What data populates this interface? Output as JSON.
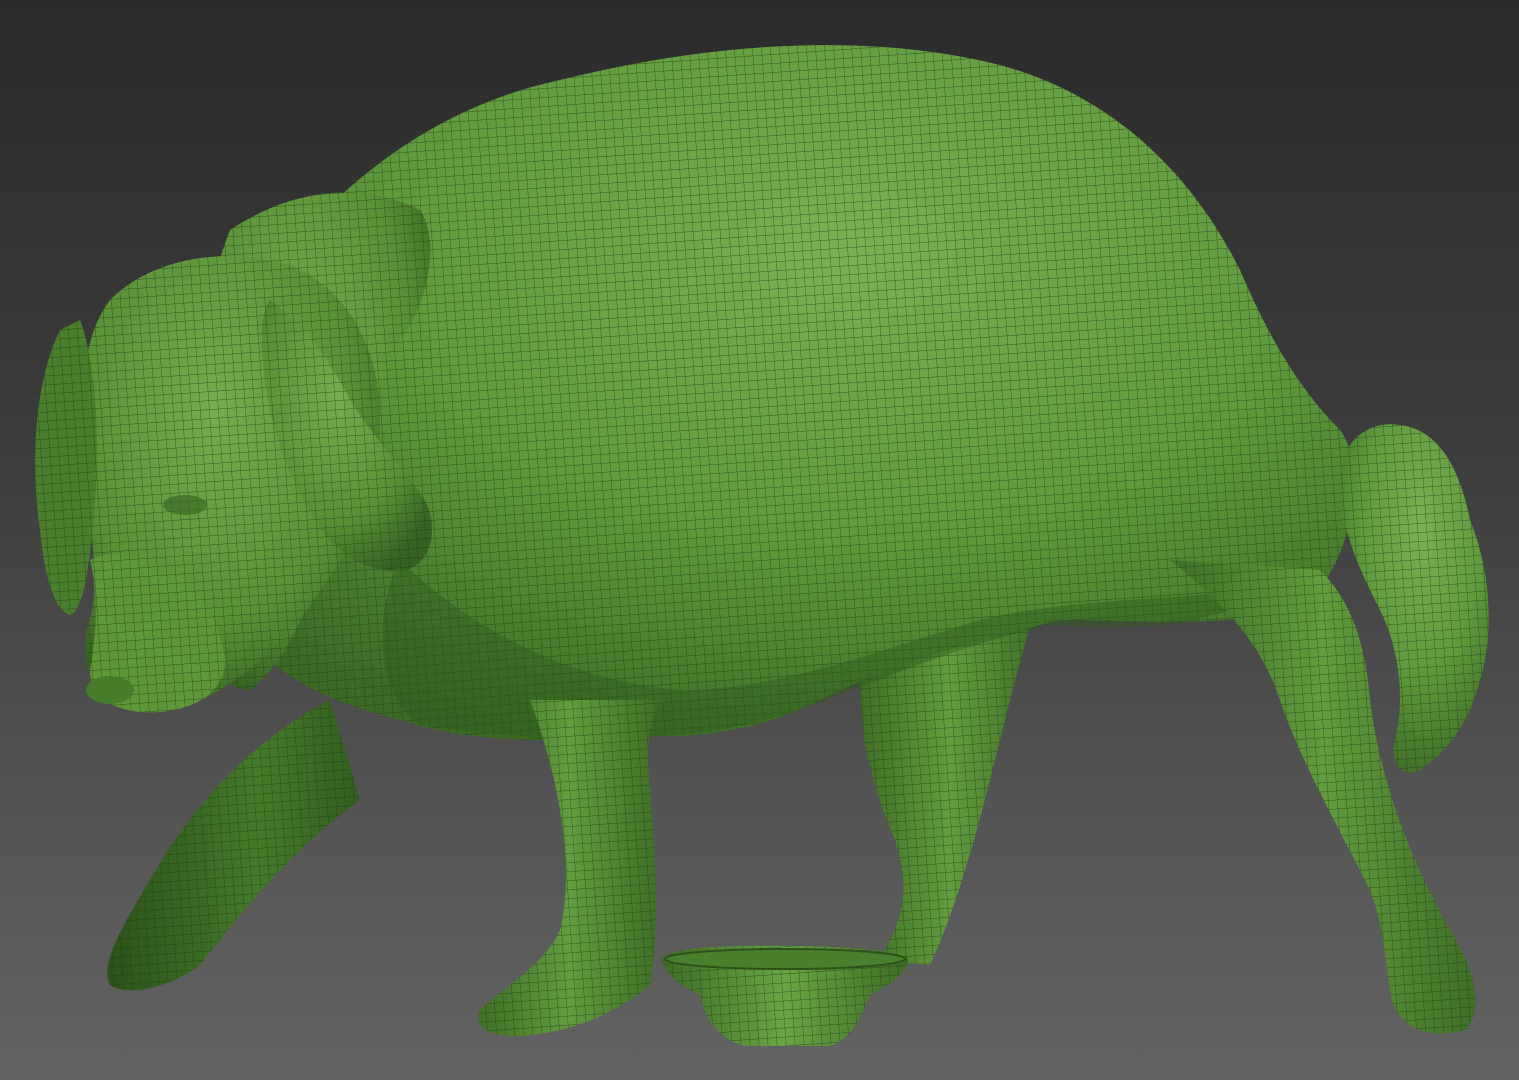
{
  "scene": {
    "background_top": "#2b2b2b",
    "background_bottom": "#636363",
    "model_color": "#5f9a3c",
    "model_shadow_color": "#2f5a1c",
    "wireframe_color": "#1e3a12",
    "objects": [
      "dog-sculpt",
      "bowl-sculpt"
    ]
  }
}
